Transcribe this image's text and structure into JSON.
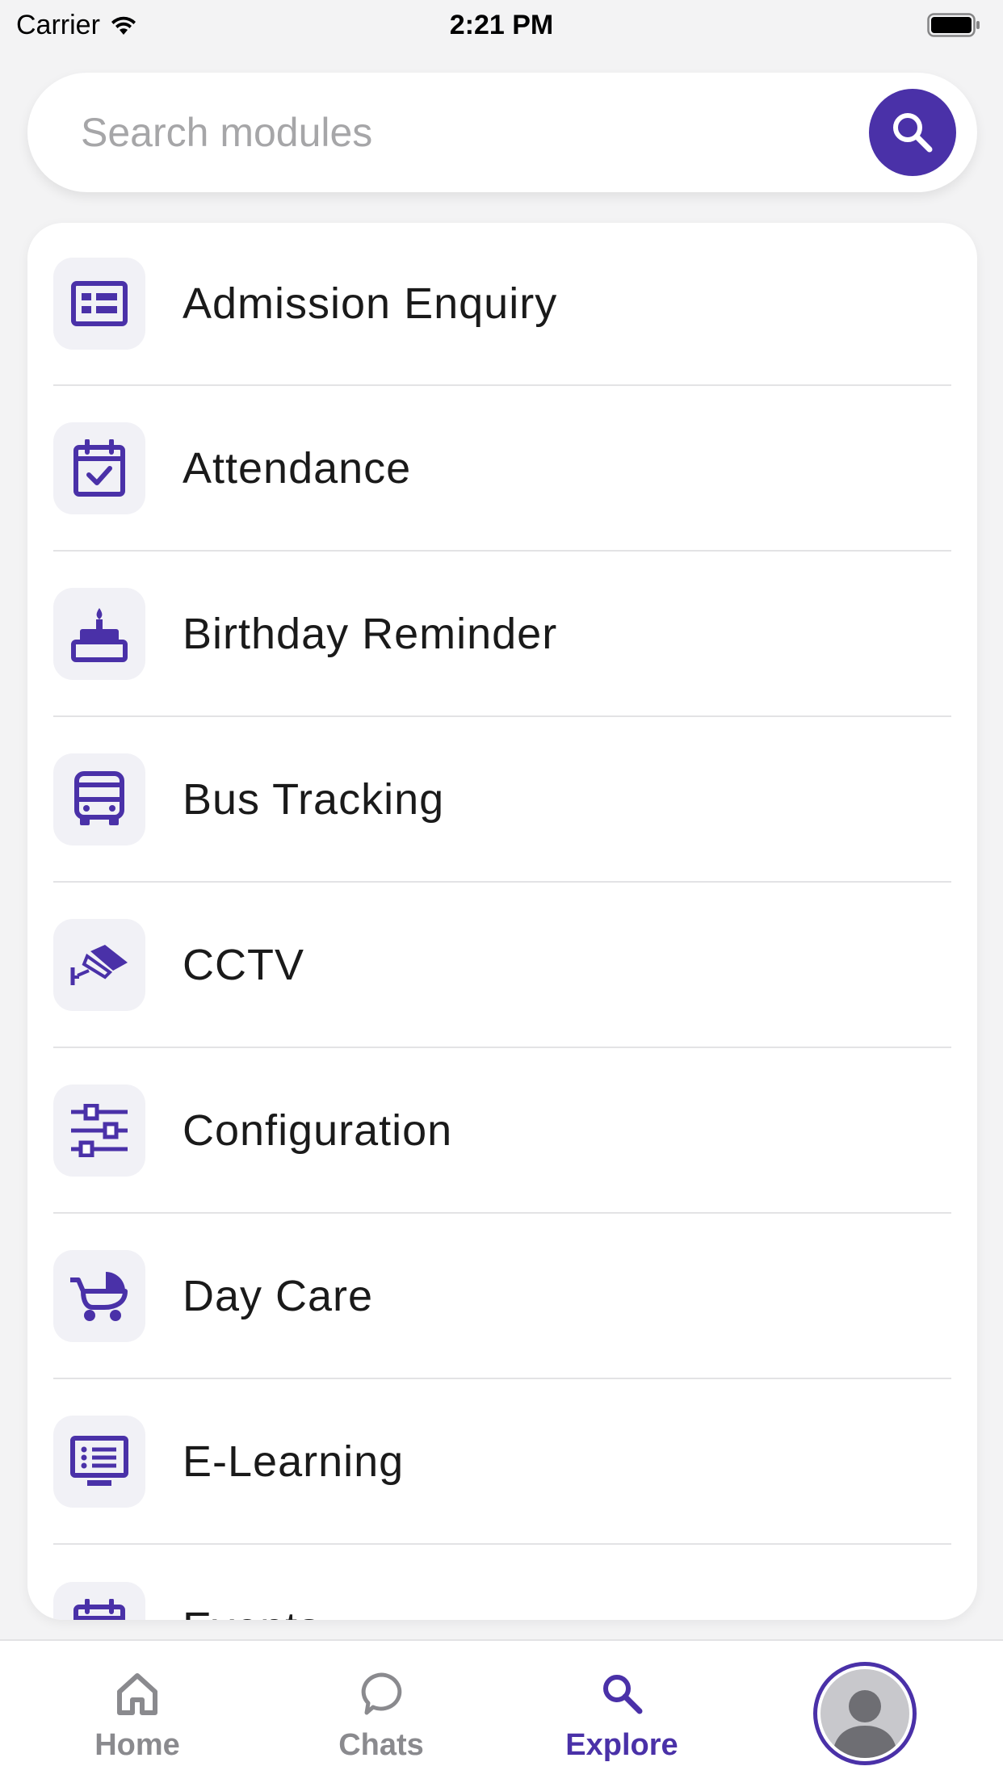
{
  "status_bar": {
    "carrier": "Carrier",
    "time": "2:21 PM"
  },
  "search": {
    "placeholder": "Search modules",
    "value": ""
  },
  "modules": [
    {
      "label": "Admission Enquiry",
      "icon": "id-card-icon"
    },
    {
      "label": "Attendance",
      "icon": "calendar-check-icon"
    },
    {
      "label": "Birthday Reminder",
      "icon": "birthday-cake-icon"
    },
    {
      "label": "Bus Tracking",
      "icon": "bus-icon"
    },
    {
      "label": "CCTV",
      "icon": "cctv-camera-icon"
    },
    {
      "label": "Configuration",
      "icon": "sliders-icon"
    },
    {
      "label": "Day Care",
      "icon": "baby-carriage-icon"
    },
    {
      "label": "E-Learning",
      "icon": "monitor-list-icon"
    },
    {
      "label": "Events",
      "icon": "calendar-icon"
    }
  ],
  "tab_bar": {
    "home": "Home",
    "chats": "Chats",
    "explore": "Explore",
    "active": "explore"
  },
  "colors": {
    "accent": "#4a31a8",
    "background": "#f3f3f4",
    "icon_tile": "#f1f1f6",
    "inactive_tab": "#8a8a8e"
  }
}
